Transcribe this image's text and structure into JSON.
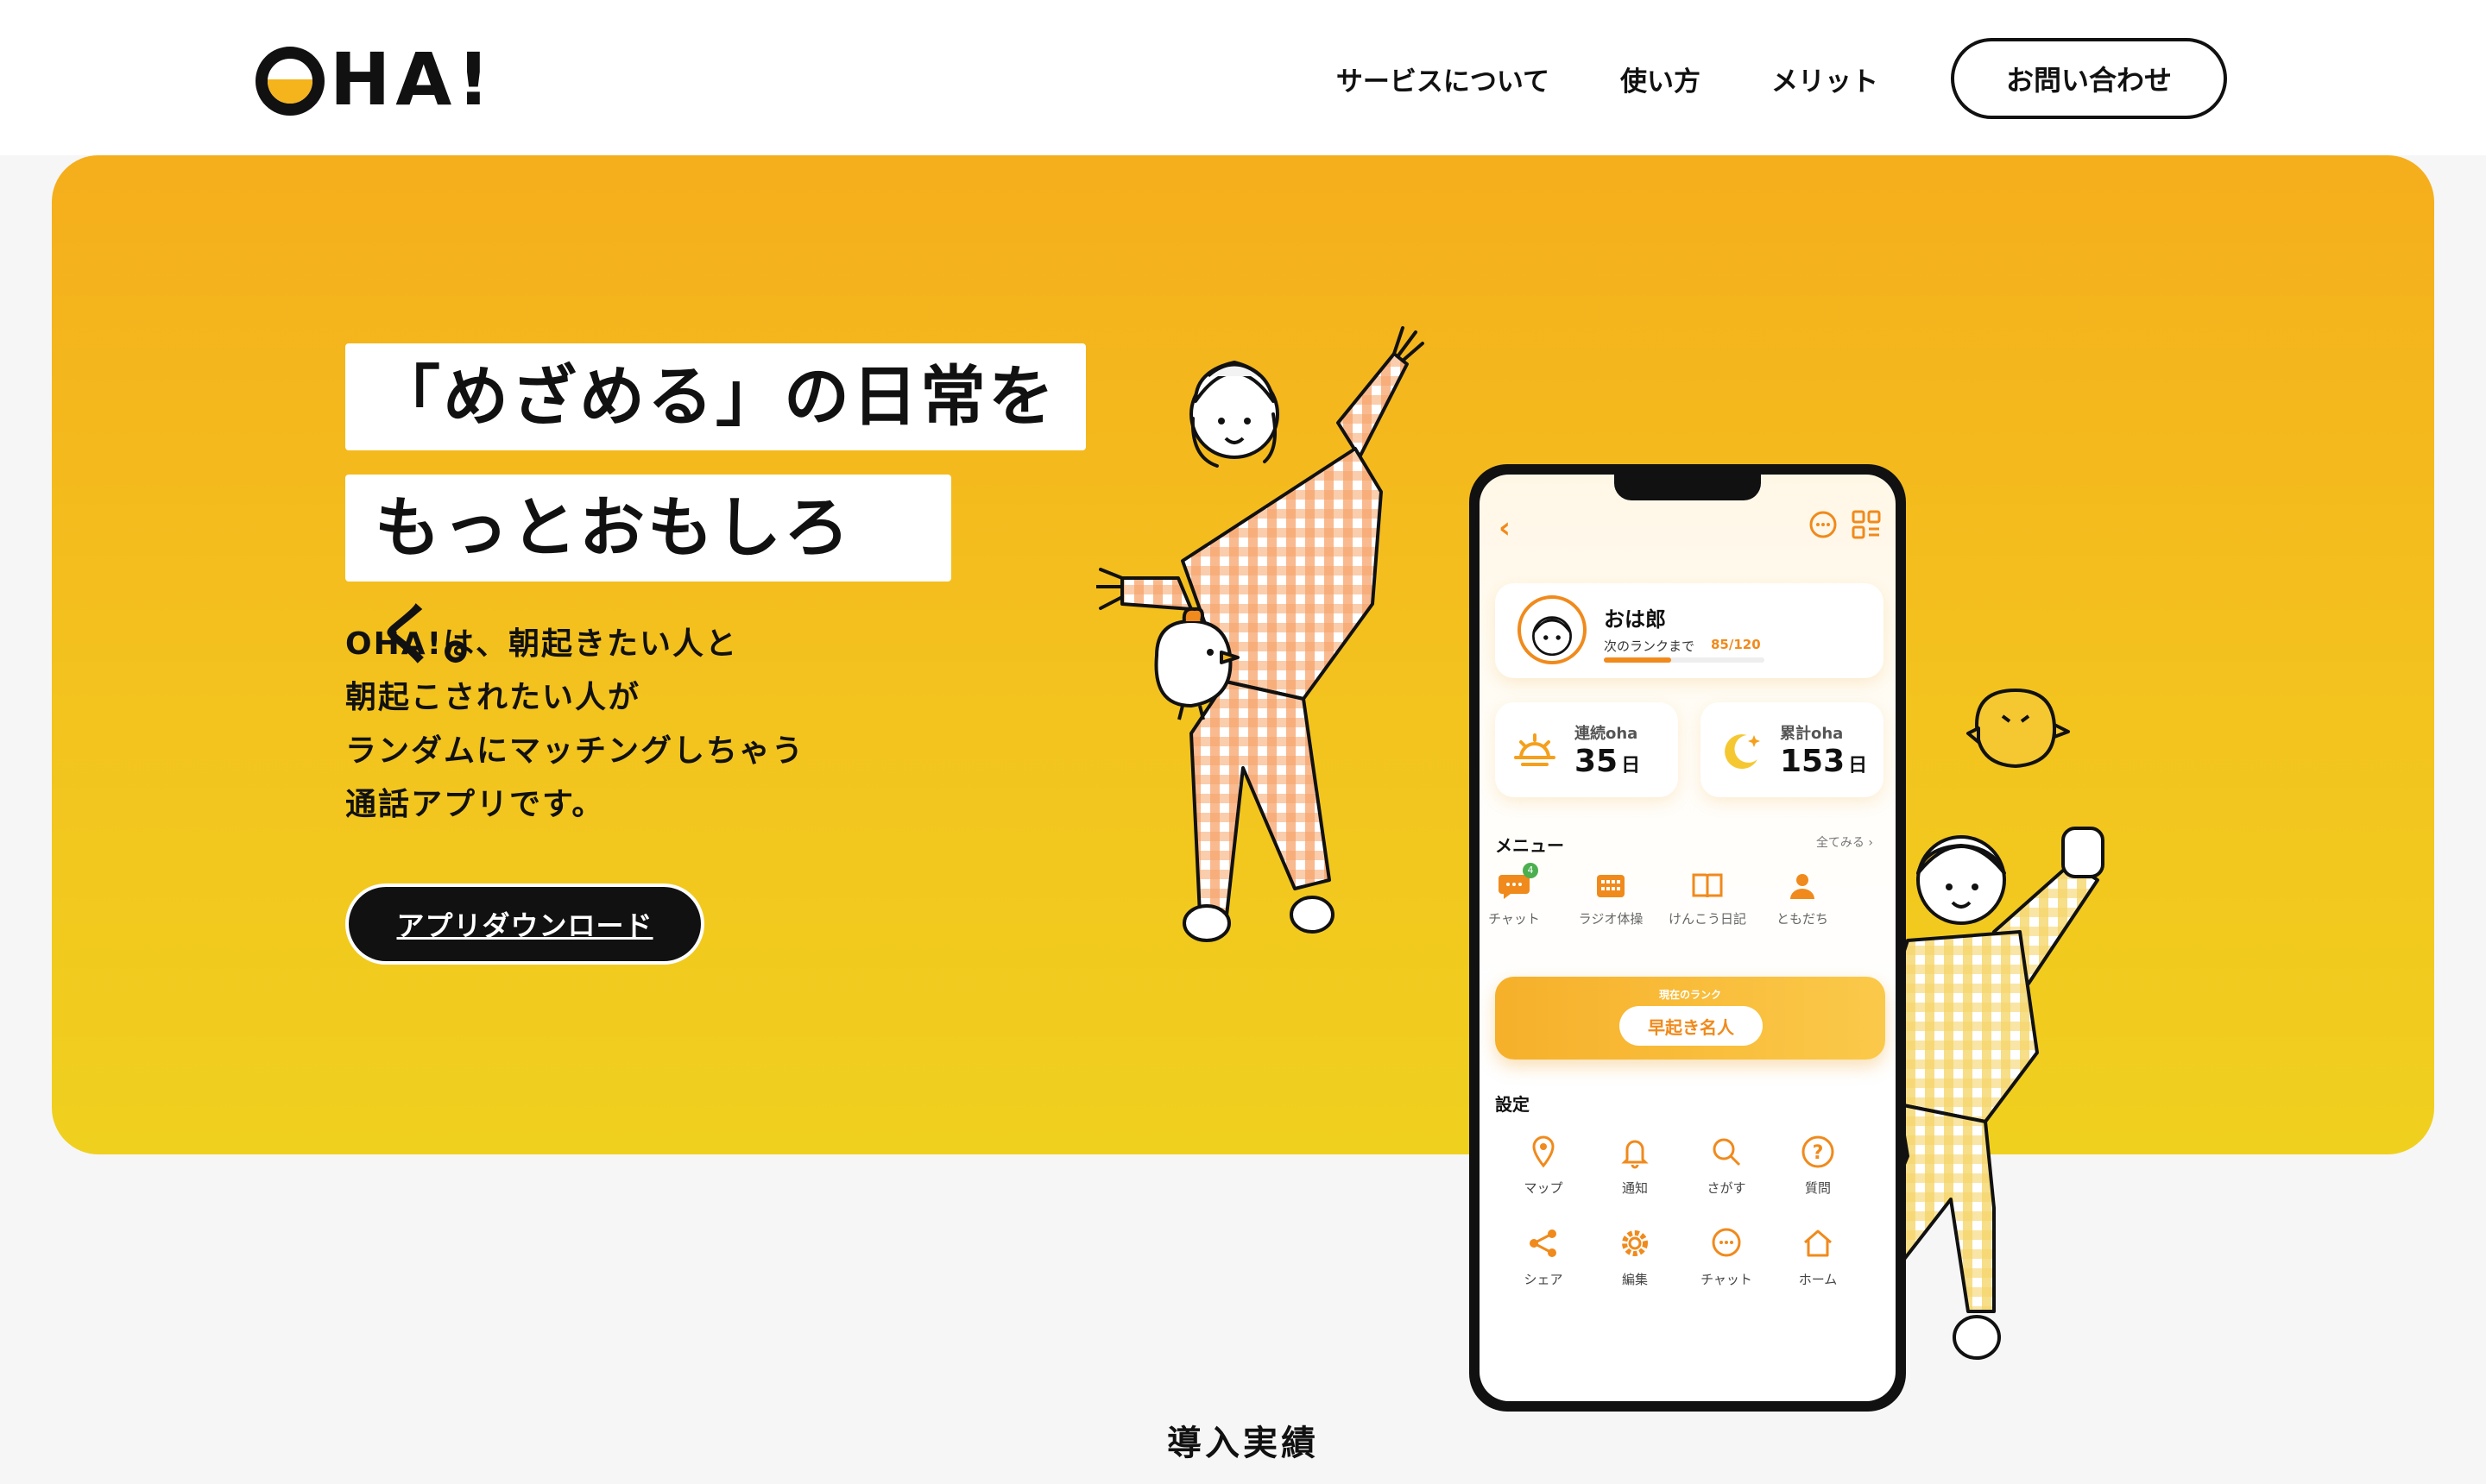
{
  "header": {
    "logo": "OHA!",
    "nav": [
      "サービスについて",
      "使い方",
      "メリット"
    ],
    "contact_label": "お問い合わせ"
  },
  "hero": {
    "headline_line1": "「めざめる」の日常を",
    "headline_line2": "もっとおもしろく。",
    "description": [
      "OHA!は、朝起きたい人と",
      "朝起こされたい人が",
      "ランダムにマッチングしちゃう",
      "通話アプリです。"
    ],
    "download_label": "アプリダウンロード"
  },
  "phone": {
    "profile": {
      "name": "おは郎",
      "rank_label": "次のランクまで",
      "rank_value": "85/120",
      "rank_progress": 0.42
    },
    "stats": [
      {
        "label": "連続oha",
        "value": "35",
        "unit": "日",
        "icon": "sunrise-icon"
      },
      {
        "label": "累計oha",
        "value": "153",
        "unit": "日",
        "icon": "moon-icon"
      }
    ],
    "menu_title": "メニュー",
    "menu_more": "全てみる ›",
    "menu": [
      {
        "label": "チャット",
        "icon": "chat-bubble-icon",
        "badge": "4"
      },
      {
        "label": "ラジオ体操",
        "icon": "calendar-icon"
      },
      {
        "label": "けんこう日記",
        "icon": "book-icon"
      },
      {
        "label": "ともだち",
        "icon": "person-icon"
      }
    ],
    "rank_card": {
      "label": "現在のランク",
      "value": "早起き名人"
    },
    "settings_title": "設定",
    "settings": [
      {
        "label": "マップ",
        "icon": "map-pin-icon"
      },
      {
        "label": "通知",
        "icon": "bell-icon"
      },
      {
        "label": "さがす",
        "icon": "search-icon"
      },
      {
        "label": "質問",
        "icon": "question-icon"
      },
      {
        "label": "シェア",
        "icon": "share-icon"
      },
      {
        "label": "編集",
        "icon": "gear-icon"
      },
      {
        "label": "チャット",
        "icon": "chat-icon"
      },
      {
        "label": "ホーム",
        "icon": "home-icon"
      }
    ],
    "accent_color": "#f08a1c"
  },
  "section": {
    "title": "導入実績"
  },
  "colors": {
    "hero_top": "#f5ae1c",
    "hero_bottom": "#f0d01f",
    "text": "#111111",
    "bg": "#f6f6f6"
  }
}
